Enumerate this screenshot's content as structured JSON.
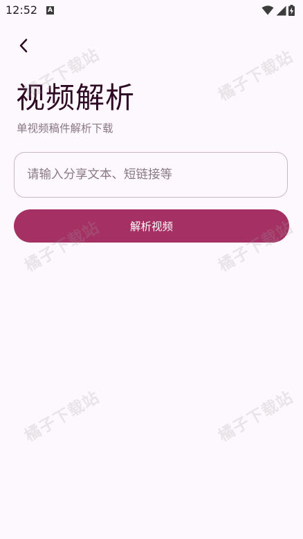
{
  "status_bar": {
    "time": "12:52",
    "notification_icon_letter": "A",
    "icons": [
      "wifi-icon",
      "cellular-signal-icon",
      "battery-charging-icon"
    ]
  },
  "header": {
    "back_icon": "chevron-left-icon",
    "title": "视频解析",
    "subtitle": "单视频稿件解析下载"
  },
  "form": {
    "input_value": "",
    "input_placeholder": "请输入分享文本、短链接等",
    "submit_label": "解析视频"
  },
  "watermark": {
    "text": "橘子下载站"
  },
  "colors": {
    "background": "#fdf8fd",
    "title": "#2e0a25",
    "subtitle": "#8a7784",
    "primary": "#a53063",
    "input_border": "#c8b8c3"
  }
}
